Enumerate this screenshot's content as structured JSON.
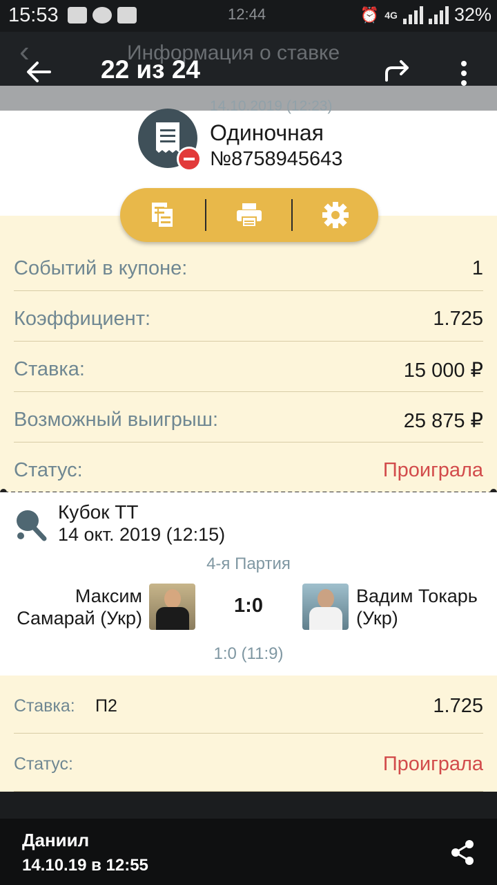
{
  "status_bar": {
    "time": "15:53",
    "ghost_time": "12:44",
    "battery": "32%",
    "network": "4G"
  },
  "toolbar": {
    "ghost_title": "Информация о ставке",
    "counter": "22 из 24"
  },
  "coupon": {
    "date": "14.10.2019 (12:23)",
    "type": "Одиночная",
    "number": "№8758945643"
  },
  "summary": {
    "rows": [
      {
        "label": "Событий в купоне:",
        "value": "1"
      },
      {
        "label": "Коэффициент:",
        "value": "1.725"
      },
      {
        "label": "Ставка:",
        "value": "15 000 ₽"
      },
      {
        "label": "Возможный выигрыш:",
        "value": "25 875 ₽"
      },
      {
        "label": "Статус:",
        "value": "Проиграла"
      }
    ]
  },
  "event": {
    "league": "Кубок ТТ",
    "date": "14 окт. 2019 (12:15)",
    "period": "4-я Партия",
    "player1_line1": "Максим",
    "player1_line2": "Самарай (Укр)",
    "player2_line1": "Вадим Токарь",
    "player2_line2": "(Укр)",
    "score": "1:0",
    "sub_score": "1:0 (11:9)"
  },
  "bet": {
    "stake_label": "Ставка:",
    "pick": "П2",
    "coef": "1.725",
    "status_label": "Статус:",
    "status": "Проиграла"
  },
  "footer": {
    "user": "Даниил",
    "time": "14.10.19 в 12:55"
  },
  "colors": {
    "accent": "#e8b84a",
    "loss": "#d24b4b",
    "panel": "#fdf5da"
  }
}
